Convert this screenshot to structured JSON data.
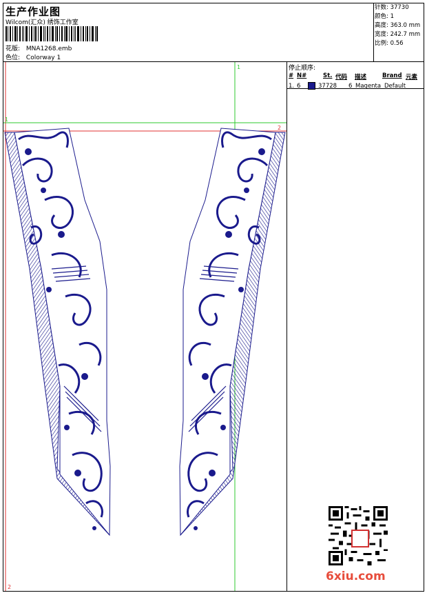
{
  "header": {
    "title": "生产作业图",
    "company": "Wilcom(汇众) 绣饰工作室",
    "design_file_label": "花版:",
    "design_file": "MNA1268.emb",
    "colorway_label": "色位:",
    "colorway": "Colorway 1"
  },
  "stats": [
    {
      "label": "针数:",
      "value": "37730"
    },
    {
      "label": "颜色:",
      "value": "1"
    },
    {
      "label": "高度:",
      "value": "363.0 mm"
    },
    {
      "label": "宽度:",
      "value": "242.7 mm"
    },
    {
      "label": "比例:",
      "value": "0.56"
    }
  ],
  "stop_sequence": {
    "title": "停止顺序:",
    "columns": [
      "#",
      "N#",
      "St.",
      "代码",
      "描述",
      "Brand",
      "元素"
    ],
    "rows": [
      {
        "index": "1.",
        "needle": "6",
        "stitches": "37728",
        "code": "6",
        "description": "Magenta",
        "brand": "Default",
        "color": "#1a1a8c"
      }
    ]
  },
  "guides": {
    "v_top_label": "1",
    "h_left_label": "1",
    "h_right_label": "2",
    "bottom_left_label": "2"
  },
  "colors": {
    "thread": "#1a1a8c",
    "guide_green": "#2ec82e",
    "guide_red": "#e03030",
    "watermark": "#e74d3c"
  },
  "watermark": "6xiu.com"
}
